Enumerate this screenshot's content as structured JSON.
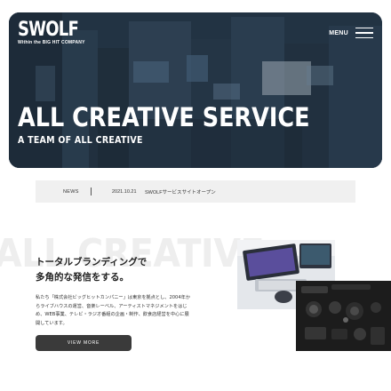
{
  "brand": {
    "logo_text": "SWOLF",
    "tagline": "Within the BIG HIT COMPANY"
  },
  "header": {
    "menu_label": "MENU"
  },
  "hero": {
    "title": "ALL CREATIVE SERVICE",
    "subtitle": "A TEAM OF ALL CREATIVE"
  },
  "news": {
    "label": "NEWS",
    "date": "2021.10.21",
    "text": "SWOLFサービスサイトオープン"
  },
  "about": {
    "background_text": "ALL CREATIVE",
    "heading_lines": [
      "トータルブランディングで",
      "多角的な発信をする。"
    ],
    "body_lines": [
      "私たち「株式会社ビッグヒットカンパニー」は東京を拠点とし、2004年か",
      "らライブハウスの運営、音楽レーベル、アーティストマネジメントをはじ",
      "め、WEB事業、テレビ・ラジオ番組の企画・制作、飲食店経営を中心に展",
      "開しています。"
    ],
    "button_label": "VIEW MORE"
  },
  "colors": {
    "button_bg": "#3a3a3a",
    "news_bg": "#f0f0f0",
    "hero_overlay": "#2b4052"
  }
}
